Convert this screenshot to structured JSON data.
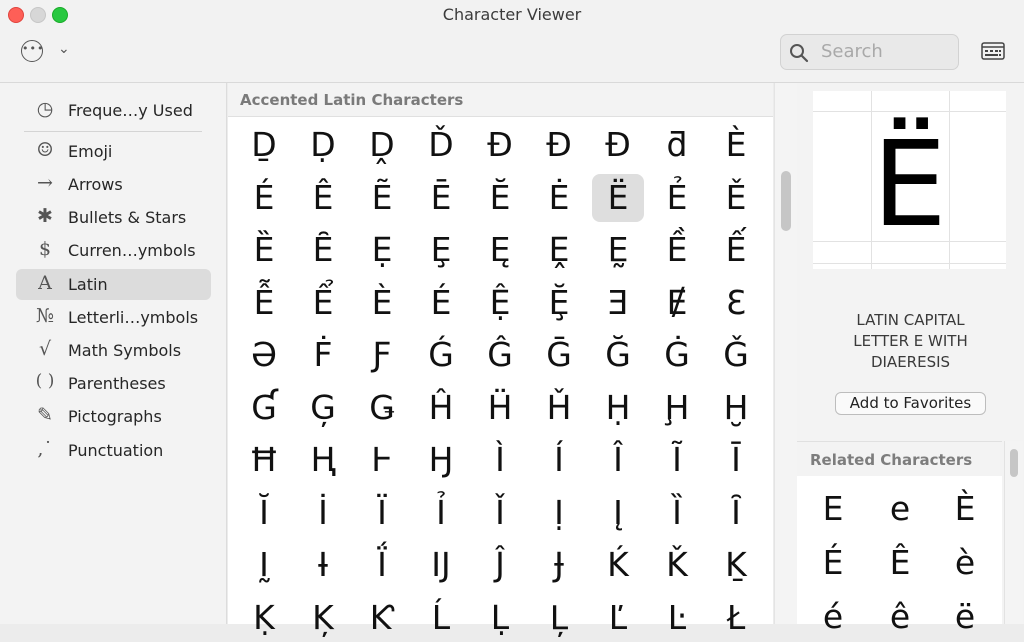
{
  "window": {
    "title": "Character Viewer"
  },
  "toolbar": {
    "actions_icon": "ellipsis-circle-icon",
    "chevron_icon": "chevron-down-icon",
    "search_placeholder": "Search",
    "keyboard_icon": "keyboard-viewer-icon"
  },
  "sidebar": {
    "items": [
      {
        "label": "Freque…y Used",
        "icon": "◷"
      },
      {
        "label": "Emoji",
        "icon": "☺"
      },
      {
        "label": "Arrows",
        "icon": "→"
      },
      {
        "label": "Bullets & Stars",
        "icon": "✱"
      },
      {
        "label": "Curren…ymbols",
        "icon": "$"
      },
      {
        "label": "Latin",
        "icon": "A"
      },
      {
        "label": "Letterli…ymbols",
        "icon": "№"
      },
      {
        "label": "Math Symbols",
        "icon": "√"
      },
      {
        "label": "Parentheses",
        "icon": "( )"
      },
      {
        "label": "Pictographs",
        "icon": "✎"
      },
      {
        "label": "Punctuation",
        "icon": "‚˙"
      }
    ],
    "selected": "Latin"
  },
  "grid": {
    "heading": "Accented Latin Characters",
    "selected": "Ë",
    "chars": [
      [
        "Ḏ",
        "Ḍ",
        "Ḓ",
        "Ď",
        "Đ",
        "Đ",
        "Ð",
        "ƌ",
        "È"
      ],
      [
        "É",
        "Ê",
        "Ẽ",
        "Ē",
        "Ĕ",
        "Ė",
        "Ë",
        "Ẻ",
        "Ě"
      ],
      [
        "Ȅ",
        "Ȇ",
        "Ẹ",
        "Ȩ",
        "Ę",
        "Ḙ",
        "Ḛ",
        "Ề",
        "Ế"
      ],
      [
        "Ễ",
        "Ể",
        "È",
        "É",
        "Ệ",
        "Ḝ",
        "Ǝ",
        "Ɇ",
        "Ɛ"
      ],
      [
        "Ə",
        "Ḟ",
        "Ƒ",
        "Ǵ",
        "Ĝ",
        "Ḡ",
        "Ğ",
        "Ġ",
        "Ǧ"
      ],
      [
        "Ɠ",
        "Ģ",
        "Ǥ",
        "Ĥ",
        "Ḧ",
        "Ȟ",
        "Ḥ",
        "Ḩ",
        "Ḫ"
      ],
      [
        "Ħ",
        "Ⱨ",
        "Ⱶ",
        "Ꜧ",
        "Ì",
        "Í",
        "Î",
        "Ĩ",
        "Ī"
      ],
      [
        "Ĭ",
        "İ",
        "Ï",
        "Ỉ",
        "Ǐ",
        "Ị",
        "Į",
        "Ȉ",
        "Ȋ"
      ],
      [
        "Ḭ",
        "Ɨ",
        "Ḯ",
        "Ĳ",
        "Ĵ",
        "Ɉ",
        "Ḱ",
        "Ǩ",
        "Ḵ"
      ],
      [
        "Ḳ",
        "Ķ",
        "Ƙ",
        "Ĺ",
        "Ḷ",
        "Ļ",
        "Ľ",
        "Ŀ",
        "Ł"
      ]
    ]
  },
  "detail": {
    "glyph": "Ë",
    "name": "LATIN CAPITAL LETTER E WITH DIAERESIS",
    "name_lines": [
      "LATIN CAPITAL",
      "LETTER E WITH",
      "DIAERESIS"
    ],
    "add_favorites": "Add to Favorites",
    "related_heading": "Related Characters",
    "related": [
      "E",
      "e",
      "È",
      "É",
      "Ê",
      "è",
      "é",
      "ê",
      "ë"
    ]
  }
}
